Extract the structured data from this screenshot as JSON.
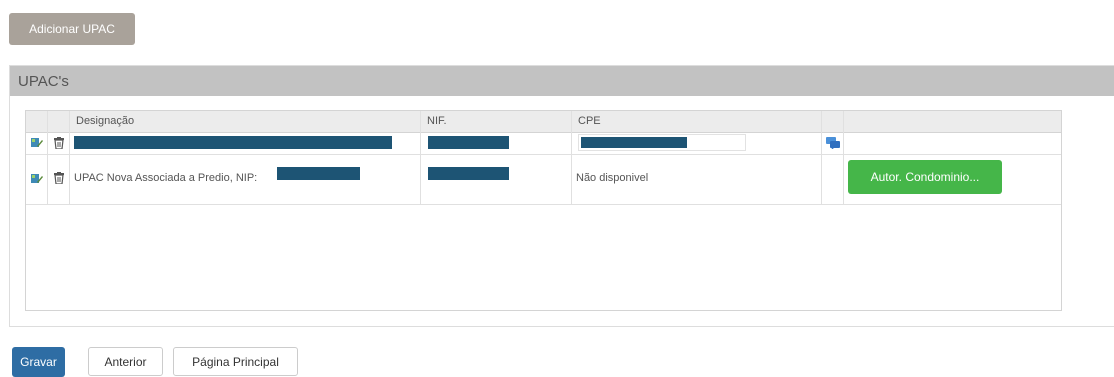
{
  "toolbar": {
    "add_label": "Adicionar UPAC"
  },
  "panel": {
    "title": "UPAC's"
  },
  "table": {
    "headers": [
      "Designação",
      "NIF.",
      "CPE"
    ],
    "rows": [
      {
        "designacao": "",
        "nif": "",
        "cpe": "",
        "action": ""
      },
      {
        "designacao": "UPAC Nova Associada a Predio, NIP:",
        "nif": "",
        "cpe": "Não disponivel",
        "action": "Autor. Condominio..."
      }
    ]
  },
  "footer": {
    "save_label": "Gravar",
    "prev_label": "Anterior",
    "home_label": "Página Principal"
  },
  "colors": {
    "redaction": "#1d5474",
    "primary": "#2e6da4",
    "success": "#45b649",
    "add_button": "#a9a29a",
    "panel_header": "#c2c2c2"
  }
}
